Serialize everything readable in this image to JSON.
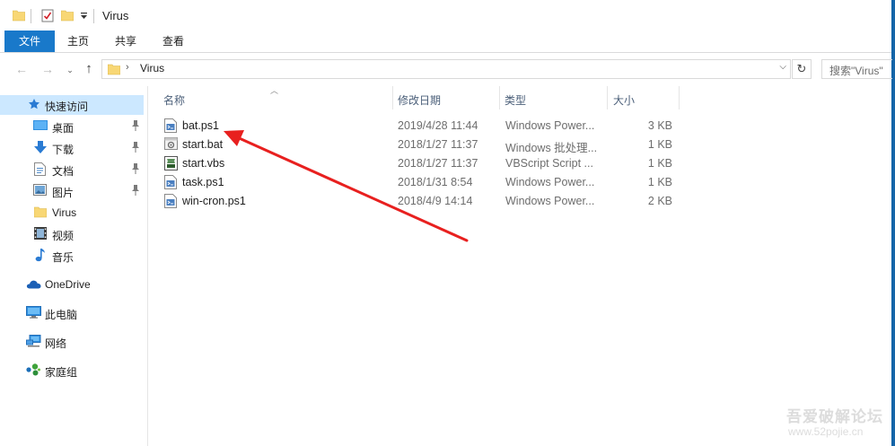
{
  "window": {
    "title": "Virus"
  },
  "ribbon": {
    "tabs": [
      {
        "label": "文件",
        "active": true
      },
      {
        "label": "主页"
      },
      {
        "label": "共享"
      },
      {
        "label": "查看"
      }
    ]
  },
  "address": {
    "path": "Virus",
    "search_placeholder": "搜索\"Virus\""
  },
  "sidebar": {
    "items": [
      {
        "label": "快速访问",
        "icon": "star-icon",
        "selected": true
      },
      {
        "label": "桌面",
        "icon": "desktop-icon",
        "pinned": true
      },
      {
        "label": "下载",
        "icon": "download-icon",
        "pinned": true
      },
      {
        "label": "文档",
        "icon": "document-icon",
        "pinned": true
      },
      {
        "label": "图片",
        "icon": "pictures-icon",
        "pinned": true
      },
      {
        "label": "Virus",
        "icon": "folder-icon"
      },
      {
        "label": "视频",
        "icon": "video-icon"
      },
      {
        "label": "音乐",
        "icon": "music-icon"
      },
      {
        "label": "OneDrive",
        "icon": "onedrive-icon"
      },
      {
        "label": "此电脑",
        "icon": "computer-icon"
      },
      {
        "label": "网络",
        "icon": "network-icon"
      },
      {
        "label": "家庭组",
        "icon": "homegroup-icon"
      }
    ]
  },
  "columns": {
    "name": "名称",
    "date": "修改日期",
    "type": "类型",
    "size": "大小"
  },
  "files": [
    {
      "name": "bat.ps1",
      "date": "2019/4/28 11:44",
      "type": "Windows Power...",
      "size": "3 KB",
      "icon": "powershell-file-icon"
    },
    {
      "name": "start.bat",
      "date": "2018/1/27 11:37",
      "type": "Windows 批处理...",
      "size": "1 KB",
      "icon": "batch-file-icon"
    },
    {
      "name": "start.vbs",
      "date": "2018/1/27 11:37",
      "type": "VBScript Script ...",
      "size": "1 KB",
      "icon": "vbs-file-icon"
    },
    {
      "name": "task.ps1",
      "date": "2018/1/31 8:54",
      "type": "Windows Power...",
      "size": "1 KB",
      "icon": "powershell-file-icon"
    },
    {
      "name": "win-cron.ps1",
      "date": "2018/4/9 14:14",
      "type": "Windows Power...",
      "size": "2 KB",
      "icon": "powershell-file-icon"
    }
  ],
  "watermark": {
    "text": "吾爱破解论坛",
    "url": "www.52pojie.cn"
  },
  "colors": {
    "accent": "#1979ca",
    "selection": "#cce8ff",
    "annotation": "#e8201f"
  }
}
